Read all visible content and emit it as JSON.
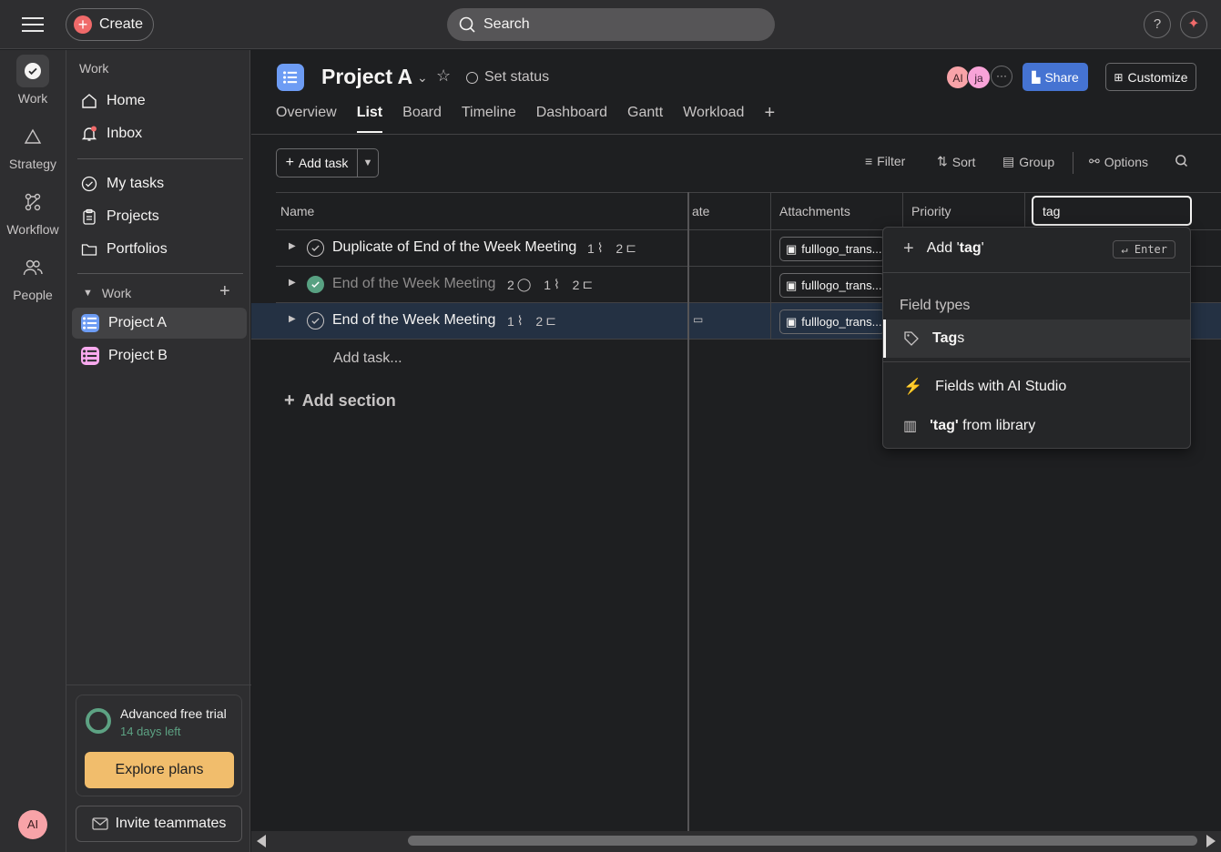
{
  "topbar": {
    "create_label": "Create",
    "search_label": "Search",
    "help_label": "?"
  },
  "rail": {
    "items": [
      {
        "label": "Work"
      },
      {
        "label": "Strategy"
      },
      {
        "label": "Workflow"
      },
      {
        "label": "People"
      }
    ],
    "avatar": "AI"
  },
  "sidebar": {
    "heading": "Work",
    "items": [
      {
        "label": "Home"
      },
      {
        "label": "Inbox"
      },
      {
        "label": "My tasks"
      },
      {
        "label": "Projects"
      },
      {
        "label": "Portfolios"
      }
    ],
    "section_label": "Work",
    "projects": [
      {
        "label": "Project A",
        "color": "#6d9cf4"
      },
      {
        "label": "Project B",
        "color": "#f9aaef"
      }
    ],
    "trial_title": "Advanced free trial",
    "trial_days": "14 days left",
    "explore_label": "Explore plans",
    "invite_label": "Invite teammates"
  },
  "project": {
    "title": "Project A",
    "set_status": "Set status",
    "avatars": [
      {
        "initials": "AI",
        "color": "#f8a3a8"
      },
      {
        "initials": "ja",
        "color": "#f8a3d8"
      }
    ],
    "share_label": "Share",
    "customize_label": "Customize",
    "tabs": [
      {
        "label": "Overview"
      },
      {
        "label": "List"
      },
      {
        "label": "Board"
      },
      {
        "label": "Timeline"
      },
      {
        "label": "Dashboard"
      },
      {
        "label": "Gantt"
      },
      {
        "label": "Workload"
      }
    ]
  },
  "toolbar": {
    "add_task": "Add task",
    "filter": "Filter",
    "sort": "Sort",
    "group": "Group",
    "options": "Options"
  },
  "columns": {
    "name": "Name",
    "date": "ate",
    "attachments": "Attachments",
    "priority": "Priority"
  },
  "tasks": [
    {
      "name": "Duplicate of End of the Week Meeting",
      "attachments_count": "1",
      "subtasks_count": "2",
      "comments_count": "",
      "attachment": "fulllogo_trans..."
    },
    {
      "name": "End of the Week Meeting",
      "attachments_count": "1",
      "subtasks_count": "2",
      "comments_count": "2",
      "attachment": "fulllogo_trans..."
    },
    {
      "name": "End of the Week Meeting",
      "attachments_count": "1",
      "subtasks_count": "2",
      "comments_count": "",
      "attachment": "fulllogo_trans..."
    }
  ],
  "add_task_inline": "Add task...",
  "add_section": "Add section",
  "field_search": {
    "value": "tag",
    "add_prefix": "Add '",
    "add_query": "tag",
    "add_suffix": "'",
    "enter_hint": "↵ Enter",
    "field_types_label": "Field types",
    "tags_match": "Tag",
    "tags_rest": "s",
    "ai_studio": "Fields with AI Studio",
    "library_query": "'tag'",
    "library_rest": " from library"
  }
}
